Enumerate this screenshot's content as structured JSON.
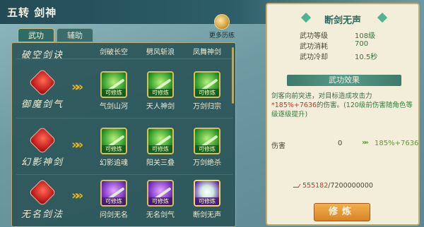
{
  "header": {
    "title": "五转 剑神"
  },
  "tabs": [
    {
      "label": "武功"
    },
    {
      "label": "辅助"
    }
  ],
  "more_practice_label": "更多历练",
  "top_row_labels": [
    "剑破长空",
    "劈风斩浪",
    "凤舞神剑"
  ],
  "top_school": "破空剑诀",
  "rows": [
    {
      "school": "御魔剑气",
      "skills": [
        {
          "name": "气剑山河",
          "tag": "可修炼",
          "color": "green"
        },
        {
          "name": "天人神剑",
          "tag": "可修炼",
          "color": "green"
        },
        {
          "name": "万剑归宗",
          "tag": "可修炼",
          "color": "green"
        }
      ]
    },
    {
      "school": "幻影神剑",
      "skills": [
        {
          "name": "幻影追魂",
          "tag": "可修炼",
          "color": "green"
        },
        {
          "name": "阳关三叠",
          "tag": "可修炼",
          "color": "green"
        },
        {
          "name": "万剑绝杀",
          "tag": "可修炼",
          "color": "green"
        }
      ]
    },
    {
      "school": "无名剑法",
      "skills": [
        {
          "name": "问剑无名",
          "tag": "可修炼",
          "color": "purple"
        },
        {
          "name": "无名剑气",
          "tag": "可修炼",
          "color": "purple"
        },
        {
          "name": "断剑无声",
          "tag": "可修炼",
          "color": "pearl"
        }
      ]
    }
  ],
  "detail": {
    "title": "断剑无声",
    "stats": [
      {
        "key": "武功等级",
        "value": "108级"
      },
      {
        "key": "武功消耗",
        "value": "700"
      },
      {
        "key": "武功冷却",
        "value": "10.5秒"
      }
    ],
    "effect_header": "武功效果",
    "desc_part1": "剑客向前突进，对目标造成攻击力",
    "desc_highlight": "*185%+7636",
    "desc_part2": "的伤害。",
    "desc_part3": "(120级前伤害随角色等级逐级提升)",
    "damage_label": "伤害",
    "damage_current": "0",
    "damage_next": "185%+7636",
    "cost_have": "555182",
    "cost_need": "/7200000000",
    "train_button": "修炼"
  }
}
